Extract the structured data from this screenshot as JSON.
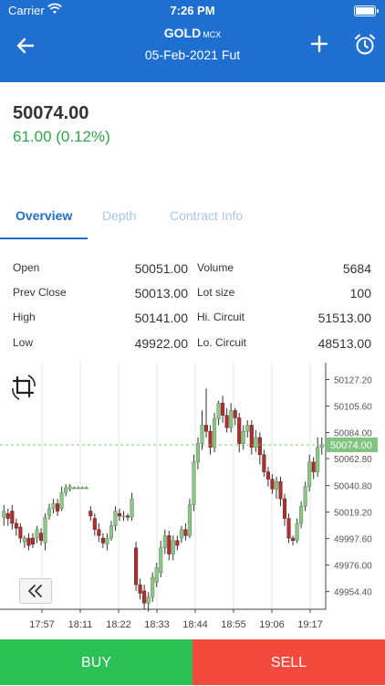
{
  "status_bar": {
    "carrier": "Carrier",
    "time": "7:26 PM"
  },
  "header": {
    "symbol": "GOLD",
    "exchange": "MCX",
    "contract": "05-Feb-2021 Fut"
  },
  "quote": {
    "price": "50074.00",
    "change": "61.00 (0.12%)"
  },
  "tabs": [
    {
      "label": "Overview"
    },
    {
      "label": "Depth"
    },
    {
      "label": "Contract Info"
    }
  ],
  "stats": {
    "left": [
      {
        "label": "Open",
        "value": "50051.00"
      },
      {
        "label": "Prev Close",
        "value": "50013.00"
      },
      {
        "label": "High",
        "value": "50141.00"
      },
      {
        "label": "Low",
        "value": "49922.00"
      }
    ],
    "right": [
      {
        "label": "Volume",
        "value": "5684"
      },
      {
        "label": "Lot size",
        "value": "100"
      },
      {
        "label": "Hi. Circuit",
        "value": "51513.00"
      },
      {
        "label": "Lo. Circuit",
        "value": "48513.00"
      }
    ]
  },
  "colors": {
    "header": "#1e6fd0",
    "up": "#2aa847",
    "buy": "#2cc155",
    "sell": "#f44a3e",
    "bull_candle": "#8ec48a",
    "bear_candle": "#a83232"
  },
  "chart_data": {
    "type": "candlestick",
    "x_ticks": [
      "17:57",
      "18:11",
      "18:22",
      "18:33",
      "18:44",
      "18:55",
      "19:06",
      "19:17"
    ],
    "y_ticks": [
      "50127.20",
      "50105.60",
      "50084.00",
      "50062.80",
      "50040.80",
      "50019.20",
      "49997.60",
      "49976.00",
      "49954.40"
    ],
    "ylim": [
      49940,
      50138
    ],
    "last_price": 50074.0,
    "last_price_label": "50074.00",
    "candles": [
      {
        "o": 50015,
        "c": 50020,
        "h": 50025,
        "l": 50008
      },
      {
        "o": 50018,
        "c": 50014,
        "h": 50022,
        "l": 50008
      },
      {
        "o": 50020,
        "c": 50010,
        "h": 50025,
        "l": 50005
      },
      {
        "o": 50010,
        "c": 50006,
        "h": 50014,
        "l": 50000
      },
      {
        "o": 50007,
        "c": 49998,
        "h": 50010,
        "l": 49994
      },
      {
        "o": 49995,
        "c": 49998,
        "h": 50000,
        "l": 49990
      },
      {
        "o": 49998,
        "c": 49992,
        "h": 50002,
        "l": 49988
      },
      {
        "o": 49998,
        "c": 49993,
        "h": 50002,
        "l": 49990
      },
      {
        "o": 49998,
        "c": 50005,
        "h": 50008,
        "l": 49994
      },
      {
        "o": 50002,
        "c": 49996,
        "h": 50006,
        "l": 49992
      },
      {
        "o": 49994,
        "c": 50015,
        "h": 50018,
        "l": 49988
      },
      {
        "o": 50016,
        "c": 50022,
        "h": 50026,
        "l": 50013
      },
      {
        "o": 50022,
        "c": 50026,
        "h": 50030,
        "l": 50018
      },
      {
        "o": 50026,
        "c": 50020,
        "h": 50030,
        "l": 50016
      },
      {
        "o": 50022,
        "c": 50035,
        "h": 50040,
        "l": 50020
      },
      {
        "o": 50035,
        "c": 50039,
        "h": 50042,
        "l": 50032
      },
      {
        "o": 50038,
        "c": 50040,
        "h": 50042,
        "l": 50036
      },
      {
        "o": 50039,
        "c": 50039,
        "h": 50040,
        "l": 50038
      },
      {
        "o": 50039,
        "c": 50039,
        "h": 50040,
        "l": 50038
      },
      {
        "o": 50039,
        "c": 50039,
        "h": 50040,
        "l": 50038
      },
      {
        "o": 50039,
        "c": 50039,
        "h": 50040,
        "l": 50038
      },
      {
        "o": 50020,
        "c": 50016,
        "h": 50024,
        "l": 50012
      },
      {
        "o": 50014,
        "c": 50005,
        "h": 50018,
        "l": 50000
      },
      {
        "o": 50005,
        "c": 50000,
        "h": 50010,
        "l": 49995
      },
      {
        "o": 49998,
        "c": 49994,
        "h": 50002,
        "l": 49990
      },
      {
        "o": 49993,
        "c": 49998,
        "h": 50002,
        "l": 49988
      },
      {
        "o": 49998,
        "c": 50008,
        "h": 50012,
        "l": 49996
      },
      {
        "o": 50008,
        "c": 50020,
        "h": 50024,
        "l": 50004
      },
      {
        "o": 50018,
        "c": 50016,
        "h": 50022,
        "l": 50012
      },
      {
        "o": 50016,
        "c": 50016,
        "h": 50020,
        "l": 50012
      },
      {
        "o": 50016,
        "c": 50015,
        "h": 50018,
        "l": 50012
      },
      {
        "o": 50015,
        "c": 50030,
        "h": 50035,
        "l": 50012
      },
      {
        "o": 49990,
        "c": 49960,
        "h": 49995,
        "l": 49955
      },
      {
        "o": 49960,
        "c": 49953,
        "h": 49965,
        "l": 49948
      },
      {
        "o": 49955,
        "c": 49945,
        "h": 49960,
        "l": 49940
      },
      {
        "o": 49945,
        "c": 49950,
        "h": 49954,
        "l": 49938
      },
      {
        "o": 49950,
        "c": 49966,
        "h": 49970,
        "l": 49946
      },
      {
        "o": 49962,
        "c": 49974,
        "h": 49978,
        "l": 49958
      },
      {
        "o": 49970,
        "c": 49990,
        "h": 49996,
        "l": 49966
      },
      {
        "o": 49990,
        "c": 50000,
        "h": 50005,
        "l": 49985
      },
      {
        "o": 50000,
        "c": 49985,
        "h": 50004,
        "l": 49980
      },
      {
        "o": 49985,
        "c": 49996,
        "h": 50000,
        "l": 49980
      },
      {
        "o": 49996,
        "c": 49992,
        "h": 50000,
        "l": 49988
      },
      {
        "o": 49998,
        "c": 50005,
        "h": 50008,
        "l": 49994
      },
      {
        "o": 50005,
        "c": 50000,
        "h": 50010,
        "l": 49996
      },
      {
        "o": 50000,
        "c": 50025,
        "h": 50030,
        "l": 49998
      },
      {
        "o": 50025,
        "c": 50060,
        "h": 50066,
        "l": 50020
      },
      {
        "o": 50060,
        "c": 50075,
        "h": 50080,
        "l": 50054
      },
      {
        "o": 50075,
        "c": 50090,
        "h": 50102,
        "l": 50070
      },
      {
        "o": 50090,
        "c": 50085,
        "h": 50120,
        "l": 50080
      },
      {
        "o": 50085,
        "c": 50072,
        "h": 50090,
        "l": 50066
      },
      {
        "o": 50072,
        "c": 50095,
        "h": 50100,
        "l": 50068
      },
      {
        "o": 50095,
        "c": 50108,
        "h": 50110,
        "l": 50090
      },
      {
        "o": 50108,
        "c": 50098,
        "h": 50114,
        "l": 50092
      },
      {
        "o": 50098,
        "c": 50088,
        "h": 50104,
        "l": 50084
      },
      {
        "o": 50088,
        "c": 50102,
        "h": 50108,
        "l": 50084
      },
      {
        "o": 50102,
        "c": 50096,
        "h": 50104,
        "l": 50090
      },
      {
        "o": 50096,
        "c": 50075,
        "h": 50100,
        "l": 50068
      },
      {
        "o": 50075,
        "c": 50085,
        "h": 50090,
        "l": 50070
      },
      {
        "o": 50085,
        "c": 50090,
        "h": 50094,
        "l": 50080
      },
      {
        "o": 50090,
        "c": 50072,
        "h": 50094,
        "l": 50066
      },
      {
        "o": 50072,
        "c": 50080,
        "h": 50086,
        "l": 50068
      },
      {
        "o": 50080,
        "c": 50066,
        "h": 50084,
        "l": 50058
      },
      {
        "o": 50066,
        "c": 50052,
        "h": 50070,
        "l": 50048
      },
      {
        "o": 50052,
        "c": 50046,
        "h": 50056,
        "l": 50040
      },
      {
        "o": 50046,
        "c": 50038,
        "h": 50050,
        "l": 50034
      },
      {
        "o": 50038,
        "c": 50044,
        "h": 50048,
        "l": 50030
      },
      {
        "o": 50044,
        "c": 50030,
        "h": 50048,
        "l": 50024
      },
      {
        "o": 50030,
        "c": 50014,
        "h": 50034,
        "l": 50008
      },
      {
        "o": 50014,
        "c": 49998,
        "h": 50018,
        "l": 49994
      },
      {
        "o": 49998,
        "c": 49996,
        "h": 50000,
        "l": 49992
      },
      {
        "o": 49996,
        "c": 50010,
        "h": 50014,
        "l": 49994
      },
      {
        "o": 50010,
        "c": 50024,
        "h": 50028,
        "l": 50006
      },
      {
        "o": 50024,
        "c": 50040,
        "h": 50044,
        "l": 50020
      },
      {
        "o": 50040,
        "c": 50060,
        "h": 50066,
        "l": 50036
      },
      {
        "o": 50060,
        "c": 50052,
        "h": 50064,
        "l": 50046
      },
      {
        "o": 50052,
        "c": 50072,
        "h": 50080,
        "l": 50048
      },
      {
        "o": 50072,
        "c": 50074,
        "h": 50080,
        "l": 50066
      }
    ]
  },
  "actions": {
    "buy": "BUY",
    "sell": "SELL"
  }
}
